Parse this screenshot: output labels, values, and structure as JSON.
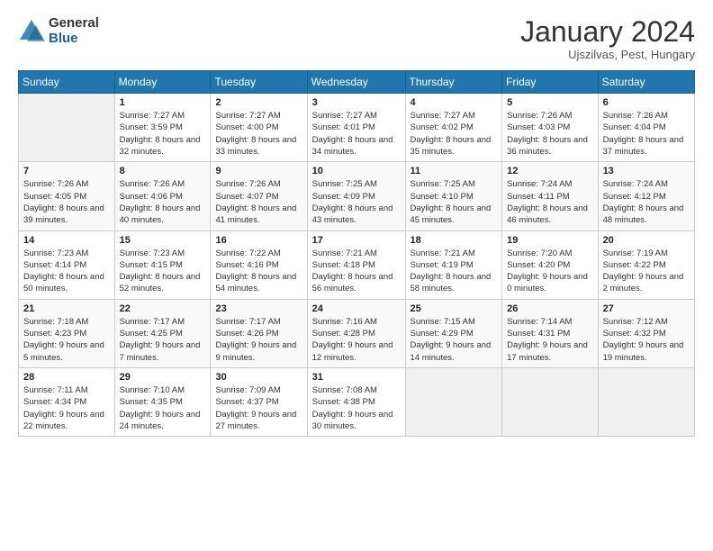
{
  "logo": {
    "general": "General",
    "blue": "Blue"
  },
  "header": {
    "month": "January 2024",
    "location": "Ujszilvas, Pest, Hungary"
  },
  "weekdays": [
    "Sunday",
    "Monday",
    "Tuesday",
    "Wednesday",
    "Thursday",
    "Friday",
    "Saturday"
  ],
  "weeks": [
    [
      {
        "day": "",
        "sunrise": "",
        "sunset": "",
        "daylight": ""
      },
      {
        "day": "1",
        "sunrise": "Sunrise: 7:27 AM",
        "sunset": "Sunset: 3:59 PM",
        "daylight": "Daylight: 8 hours and 32 minutes."
      },
      {
        "day": "2",
        "sunrise": "Sunrise: 7:27 AM",
        "sunset": "Sunset: 4:00 PM",
        "daylight": "Daylight: 8 hours and 33 minutes."
      },
      {
        "day": "3",
        "sunrise": "Sunrise: 7:27 AM",
        "sunset": "Sunset: 4:01 PM",
        "daylight": "Daylight: 8 hours and 34 minutes."
      },
      {
        "day": "4",
        "sunrise": "Sunrise: 7:27 AM",
        "sunset": "Sunset: 4:02 PM",
        "daylight": "Daylight: 8 hours and 35 minutes."
      },
      {
        "day": "5",
        "sunrise": "Sunrise: 7:26 AM",
        "sunset": "Sunset: 4:03 PM",
        "daylight": "Daylight: 8 hours and 36 minutes."
      },
      {
        "day": "6",
        "sunrise": "Sunrise: 7:26 AM",
        "sunset": "Sunset: 4:04 PM",
        "daylight": "Daylight: 8 hours and 37 minutes."
      }
    ],
    [
      {
        "day": "7",
        "sunrise": "Sunrise: 7:26 AM",
        "sunset": "Sunset: 4:05 PM",
        "daylight": "Daylight: 8 hours and 39 minutes."
      },
      {
        "day": "8",
        "sunrise": "Sunrise: 7:26 AM",
        "sunset": "Sunset: 4:06 PM",
        "daylight": "Daylight: 8 hours and 40 minutes."
      },
      {
        "day": "9",
        "sunrise": "Sunrise: 7:26 AM",
        "sunset": "Sunset: 4:07 PM",
        "daylight": "Daylight: 8 hours and 41 minutes."
      },
      {
        "day": "10",
        "sunrise": "Sunrise: 7:25 AM",
        "sunset": "Sunset: 4:09 PM",
        "daylight": "Daylight: 8 hours and 43 minutes."
      },
      {
        "day": "11",
        "sunrise": "Sunrise: 7:25 AM",
        "sunset": "Sunset: 4:10 PM",
        "daylight": "Daylight: 8 hours and 45 minutes."
      },
      {
        "day": "12",
        "sunrise": "Sunrise: 7:24 AM",
        "sunset": "Sunset: 4:11 PM",
        "daylight": "Daylight: 8 hours and 46 minutes."
      },
      {
        "day": "13",
        "sunrise": "Sunrise: 7:24 AM",
        "sunset": "Sunset: 4:12 PM",
        "daylight": "Daylight: 8 hours and 48 minutes."
      }
    ],
    [
      {
        "day": "14",
        "sunrise": "Sunrise: 7:23 AM",
        "sunset": "Sunset: 4:14 PM",
        "daylight": "Daylight: 8 hours and 50 minutes."
      },
      {
        "day": "15",
        "sunrise": "Sunrise: 7:23 AM",
        "sunset": "Sunset: 4:15 PM",
        "daylight": "Daylight: 8 hours and 52 minutes."
      },
      {
        "day": "16",
        "sunrise": "Sunrise: 7:22 AM",
        "sunset": "Sunset: 4:16 PM",
        "daylight": "Daylight: 8 hours and 54 minutes."
      },
      {
        "day": "17",
        "sunrise": "Sunrise: 7:21 AM",
        "sunset": "Sunset: 4:18 PM",
        "daylight": "Daylight: 8 hours and 56 minutes."
      },
      {
        "day": "18",
        "sunrise": "Sunrise: 7:21 AM",
        "sunset": "Sunset: 4:19 PM",
        "daylight": "Daylight: 8 hours and 58 minutes."
      },
      {
        "day": "19",
        "sunrise": "Sunrise: 7:20 AM",
        "sunset": "Sunset: 4:20 PM",
        "daylight": "Daylight: 9 hours and 0 minutes."
      },
      {
        "day": "20",
        "sunrise": "Sunrise: 7:19 AM",
        "sunset": "Sunset: 4:22 PM",
        "daylight": "Daylight: 9 hours and 2 minutes."
      }
    ],
    [
      {
        "day": "21",
        "sunrise": "Sunrise: 7:18 AM",
        "sunset": "Sunset: 4:23 PM",
        "daylight": "Daylight: 9 hours and 5 minutes."
      },
      {
        "day": "22",
        "sunrise": "Sunrise: 7:17 AM",
        "sunset": "Sunset: 4:25 PM",
        "daylight": "Daylight: 9 hours and 7 minutes."
      },
      {
        "day": "23",
        "sunrise": "Sunrise: 7:17 AM",
        "sunset": "Sunset: 4:26 PM",
        "daylight": "Daylight: 9 hours and 9 minutes."
      },
      {
        "day": "24",
        "sunrise": "Sunrise: 7:16 AM",
        "sunset": "Sunset: 4:28 PM",
        "daylight": "Daylight: 9 hours and 12 minutes."
      },
      {
        "day": "25",
        "sunrise": "Sunrise: 7:15 AM",
        "sunset": "Sunset: 4:29 PM",
        "daylight": "Daylight: 9 hours and 14 minutes."
      },
      {
        "day": "26",
        "sunrise": "Sunrise: 7:14 AM",
        "sunset": "Sunset: 4:31 PM",
        "daylight": "Daylight: 9 hours and 17 minutes."
      },
      {
        "day": "27",
        "sunrise": "Sunrise: 7:12 AM",
        "sunset": "Sunset: 4:32 PM",
        "daylight": "Daylight: 9 hours and 19 minutes."
      }
    ],
    [
      {
        "day": "28",
        "sunrise": "Sunrise: 7:11 AM",
        "sunset": "Sunset: 4:34 PM",
        "daylight": "Daylight: 9 hours and 22 minutes."
      },
      {
        "day": "29",
        "sunrise": "Sunrise: 7:10 AM",
        "sunset": "Sunset: 4:35 PM",
        "daylight": "Daylight: 9 hours and 24 minutes."
      },
      {
        "day": "30",
        "sunrise": "Sunrise: 7:09 AM",
        "sunset": "Sunset: 4:37 PM",
        "daylight": "Daylight: 9 hours and 27 minutes."
      },
      {
        "day": "31",
        "sunrise": "Sunrise: 7:08 AM",
        "sunset": "Sunset: 4:38 PM",
        "daylight": "Daylight: 9 hours and 30 minutes."
      },
      {
        "day": "",
        "sunrise": "",
        "sunset": "",
        "daylight": ""
      },
      {
        "day": "",
        "sunrise": "",
        "sunset": "",
        "daylight": ""
      },
      {
        "day": "",
        "sunrise": "",
        "sunset": "",
        "daylight": ""
      }
    ]
  ]
}
